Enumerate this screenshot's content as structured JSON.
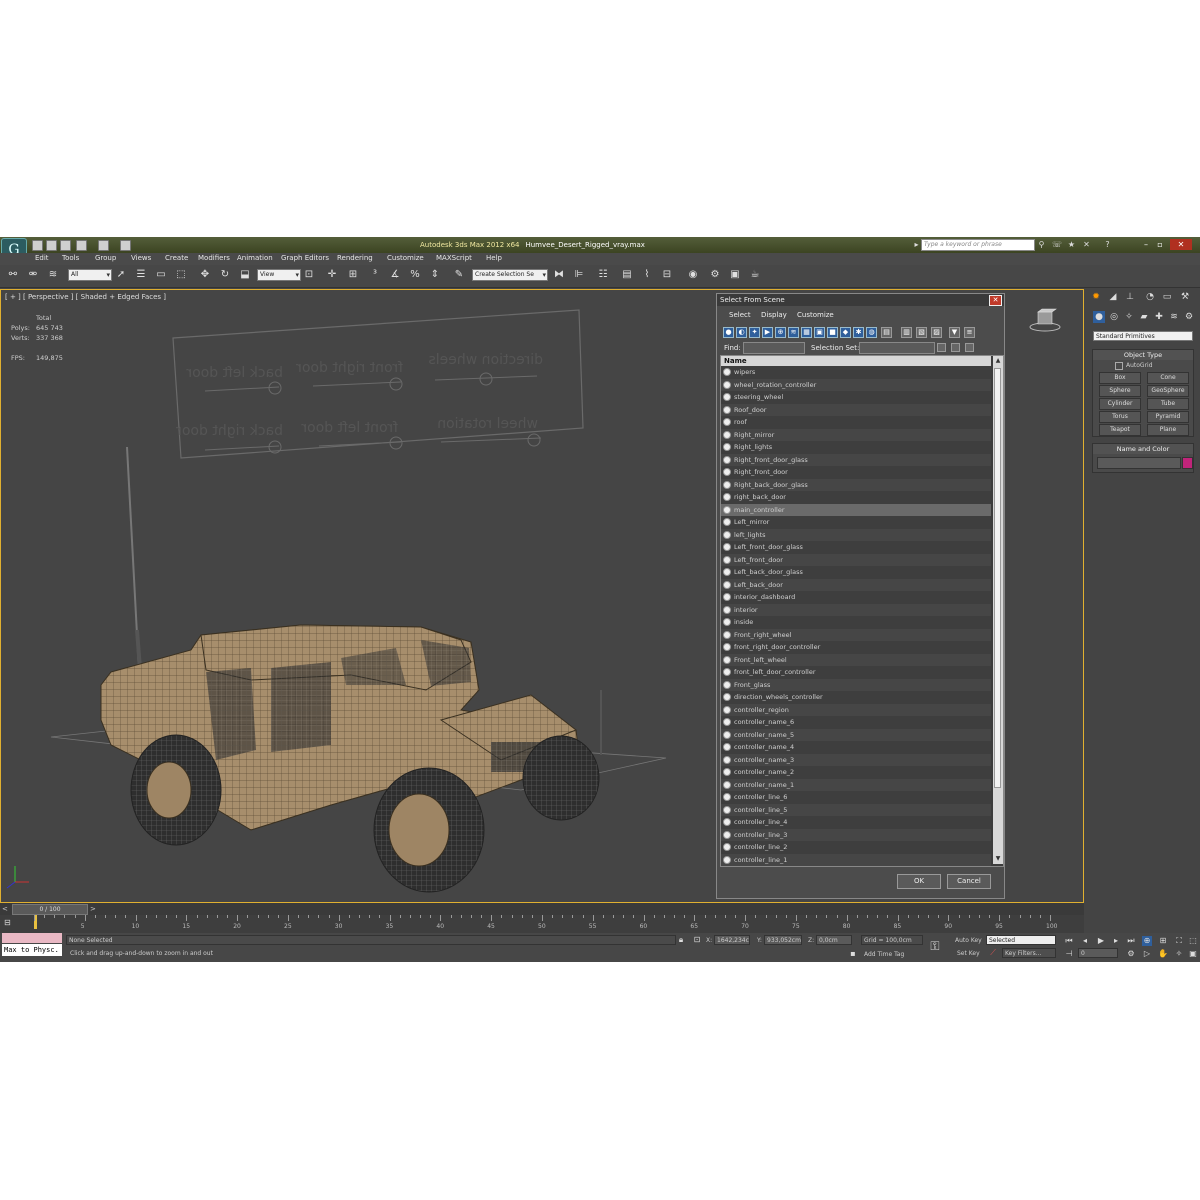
{
  "window": {
    "app": "Autodesk 3ds Max  2012 x64",
    "file": "Humvee_Desert_Rigged_vray.max",
    "search_placeholder": "Type a keyword or phrase"
  },
  "menu": [
    "Edit",
    "Tools",
    "Group",
    "Views",
    "Create",
    "Modifiers",
    "Animation",
    "Graph Editors",
    "Rendering",
    "Customize",
    "MAXScript",
    "Help"
  ],
  "toolbar": {
    "filter": "All",
    "ref_coord": "View",
    "selection_set": "Create Selection Se"
  },
  "viewport": {
    "label": "[ + ] [ Perspective ] [ Shaded + Edged Faces ]",
    "stats": {
      "header": "Total",
      "polys_label": "Polys:",
      "polys": "645 743",
      "verts_label": "Verts:",
      "verts": "337 368",
      "fps_label": "FPS:",
      "fps": "149,875"
    },
    "board_labels": [
      "back left door",
      "front right door",
      "direction wheels",
      "back right door",
      "front left door",
      "wheel rotation"
    ]
  },
  "dialog": {
    "title": "Select From Scene",
    "menu": [
      "Select",
      "Display",
      "Customize"
    ],
    "find_label": "Find:",
    "selection_set_label": "Selection Set:",
    "column": "Name",
    "items": [
      "wipers",
      "wheel_rotation_controller",
      "steering_wheel",
      "Roof_door",
      "roof",
      "Right_mirror",
      "Right_lights",
      "Right_front_door_glass",
      "Right_front_door",
      "Right_back_door_glass",
      "right_back_door",
      "main_controller",
      "Left_mirror",
      "left_lights",
      "Left_front_door_glass",
      "Left_front_door",
      "Left_back_door_glass",
      "Left_back_door",
      "interior_dashboard",
      "interior",
      "inside",
      "Front_right_wheel",
      "front_right_door_controller",
      "Front_left_wheel",
      "front_left_door_controller",
      "Front_glass",
      "direction_wheels_controller",
      "controller_region",
      "controller_name_6",
      "controller_name_5",
      "controller_name_4",
      "controller_name_3",
      "controller_name_2",
      "controller_name_1",
      "controller_line_6",
      "controller_line_5",
      "controller_line_4",
      "controller_line_3",
      "controller_line_2",
      "controller_line_1"
    ],
    "selected_item": "main_controller",
    "ok": "OK",
    "cancel": "Cancel"
  },
  "command_panel": {
    "category": "Standard Primitives",
    "object_type_title": "Object Type",
    "autogrid": "AutoGrid",
    "primitives": [
      "Box",
      "Cone",
      "Sphere",
      "GeoSphere",
      "Cylinder",
      "Tube",
      "Torus",
      "Pyramid",
      "Teapot",
      "Plane"
    ],
    "name_color_title": "Name and Color",
    "object_color": "#c0247a"
  },
  "timeline": {
    "frame": "0 / 100",
    "ticks": [
      "0",
      "5",
      "10",
      "15",
      "20",
      "25",
      "30",
      "35",
      "40",
      "45",
      "50",
      "55",
      "60",
      "65",
      "70",
      "75",
      "80",
      "85",
      "90",
      "95",
      "100"
    ]
  },
  "status": {
    "maxscript": "Max to Physc.",
    "selection": "None Selected",
    "prompt": "Click and drag up-and-down to zoom in and out",
    "x_label": "X:",
    "x": "1642,234c",
    "y_label": "Y:",
    "y": "933,052cm",
    "z_label": "Z:",
    "z": "0,0cm",
    "grid": "Grid = 100,0cm",
    "add_time_tag": "Add Time Tag",
    "auto_key": "Auto Key",
    "key_mode": "Selected",
    "set_key": "Set Key",
    "key_filters": "Key Filters...",
    "current_frame": "0"
  }
}
